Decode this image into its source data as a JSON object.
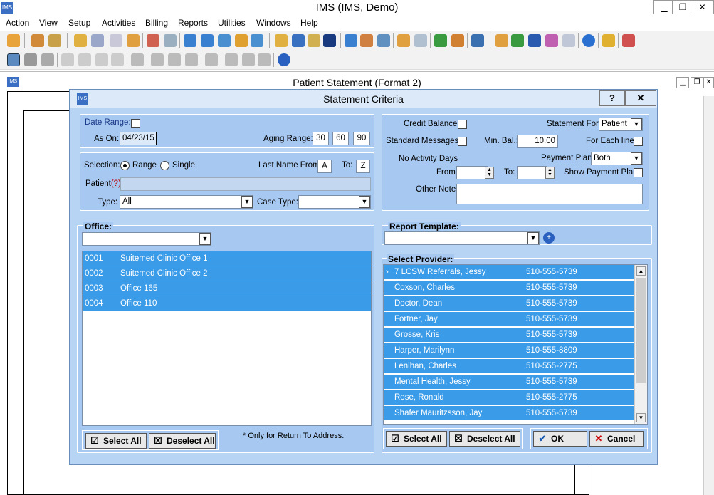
{
  "app": {
    "title": "IMS (IMS, Demo)"
  },
  "menu": [
    "Action",
    "View",
    "Setup",
    "Activities",
    "Billing",
    "Reports",
    "Utilities",
    "Windows",
    "Help"
  ],
  "doc_window": {
    "title": "Patient Statement (Format 2)"
  },
  "dialog": {
    "title": "Statement Criteria",
    "help_label": "?",
    "close_label": "✕",
    "date_range_label": "Date Range:",
    "as_on_label": "As On:",
    "as_on_value": "04/23/15",
    "aging_range_label": "Aging Range:",
    "aging": [
      "30",
      "60",
      "90"
    ],
    "selection_label": "Selection:",
    "range_label": "Range",
    "single_label": "Single",
    "last_name_from_label": "Last Name From:",
    "last_name_from": "A",
    "to_label": "To:",
    "last_name_to": "Z",
    "patient_label": "Patient",
    "patient_help": "(?)",
    "type_label": "Type:",
    "type_value": "All",
    "case_type_label": "Case Type:",
    "credit_balance_label": "Credit Balance:",
    "statement_for_label": "Statement For:",
    "statement_for_value": "Patient",
    "standard_messages_label": "Standard Messages:",
    "min_bal_label": "Min. Bal.:",
    "min_bal_value": "10.00",
    "for_each_line_label": "For Each line:",
    "no_activity_label": "No Activity Days",
    "payment_plan_label": "Payment Plan:",
    "payment_plan_value": "Both",
    "from_label": "From:",
    "to2_label": "To:",
    "show_payment_plan_label": "Show Payment Plan:",
    "other_note_label": "Other Note:",
    "office_label": "Office:",
    "offices": [
      {
        "code": "0001",
        "name": "Suitemed Clinic Office 1"
      },
      {
        "code": "0002",
        "name": "Suitemed Clinic Office 2"
      },
      {
        "code": "0003",
        "name": "Office 165"
      },
      {
        "code": "0004",
        "name": "Office 110"
      }
    ],
    "select_all_label": "Select All",
    "deselect_all_label": "Deselect All",
    "return_note": "* Only for Return To Address.",
    "report_template_label": "Report Template:",
    "select_provider_label": "Select Provider:",
    "providers": [
      {
        "name": "7 LCSW Referrals, Jessy",
        "phone": "510-555-5739"
      },
      {
        "name": "Coxson, Charles",
        "phone": "510-555-5739"
      },
      {
        "name": "Doctor, Dean",
        "phone": "510-555-5739"
      },
      {
        "name": "Fortner, Jay",
        "phone": "510-555-5739"
      },
      {
        "name": "Grosse, Kris",
        "phone": "510-555-5739"
      },
      {
        "name": "Harper, Marilynn",
        "phone": "510-555-8809"
      },
      {
        "name": "Lenihan, Charles",
        "phone": "510-555-2775"
      },
      {
        "name": "Mental Health, Jessy",
        "phone": "510-555-5739"
      },
      {
        "name": "Rose, Ronald",
        "phone": "510-555-2775"
      },
      {
        "name": "Shafer Mauritzsson, Jay",
        "phone": "510-555-5739"
      }
    ],
    "ok_label": "OK",
    "cancel_label": "Cancel"
  }
}
